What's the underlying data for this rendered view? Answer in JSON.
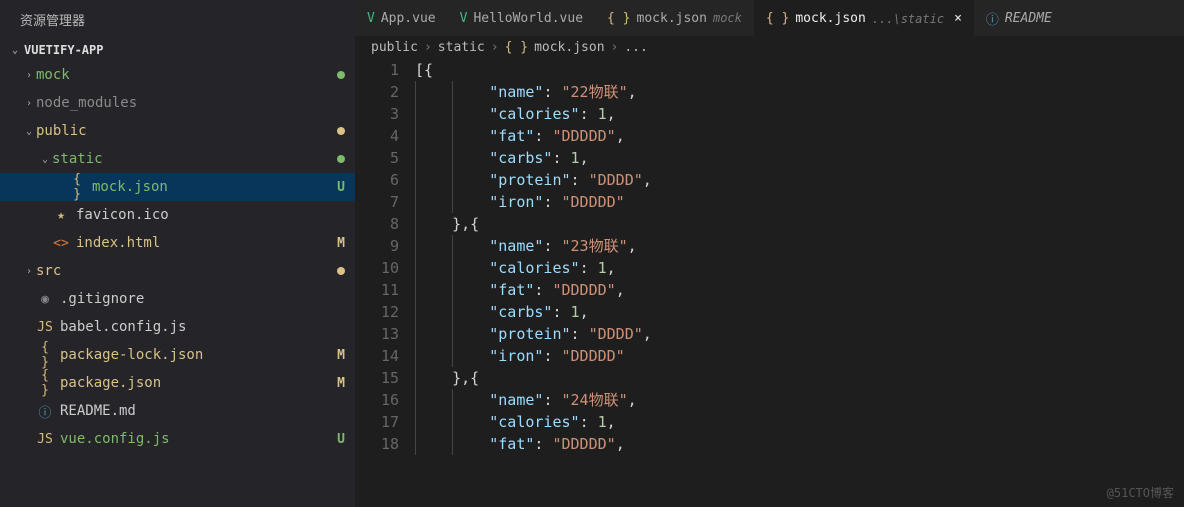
{
  "sidebar": {
    "title": "资源管理器",
    "project": "VUETIFY-APP",
    "tree": [
      {
        "indent": 1,
        "chev": "›",
        "icon": "",
        "iconColor": "",
        "label": "mock",
        "labelColor": "#7fba6a",
        "badge": "",
        "badgeColor": "",
        "dot": "#7fba6a"
      },
      {
        "indent": 1,
        "chev": "›",
        "icon": "",
        "iconColor": "",
        "label": "node_modules",
        "labelColor": "#8a8a8a",
        "badge": "",
        "badgeColor": "",
        "dot": ""
      },
      {
        "indent": 1,
        "chev": "⌄",
        "icon": "",
        "iconColor": "",
        "label": "public",
        "labelColor": "#d8c286",
        "badge": "",
        "badgeColor": "",
        "dot": "#d8c286"
      },
      {
        "indent": 2,
        "chev": "⌄",
        "icon": "",
        "iconColor": "",
        "label": "static",
        "labelColor": "#7fba6a",
        "badge": "",
        "badgeColor": "",
        "dot": "#7fba6a"
      },
      {
        "indent": 3,
        "chev": "",
        "icon": "{ }",
        "iconColor": "#d7ba7d",
        "label": "mock.json",
        "labelColor": "#7fba6a",
        "badge": "U",
        "badgeColor": "#7fba6a",
        "dot": "",
        "active": true
      },
      {
        "indent": 2,
        "chev": "",
        "icon": "★",
        "iconColor": "#d7ba7d",
        "label": "favicon.ico",
        "labelColor": "#ccc",
        "badge": "",
        "badgeColor": "",
        "dot": ""
      },
      {
        "indent": 2,
        "chev": "",
        "icon": "<>",
        "iconColor": "#e37933",
        "label": "index.html",
        "labelColor": "#d8c286",
        "badge": "M",
        "badgeColor": "#d8c286",
        "dot": ""
      },
      {
        "indent": 1,
        "chev": "›",
        "icon": "",
        "iconColor": "",
        "label": "src",
        "labelColor": "#d8c286",
        "badge": "",
        "badgeColor": "",
        "dot": "#d8c286"
      },
      {
        "indent": 1,
        "chev": "",
        "icon": "◉",
        "iconColor": "#888",
        "label": ".gitignore",
        "labelColor": "#ccc",
        "badge": "",
        "badgeColor": "",
        "dot": ""
      },
      {
        "indent": 1,
        "chev": "",
        "icon": "JS",
        "iconColor": "#d7ba7d",
        "label": "babel.config.js",
        "labelColor": "#ccc",
        "badge": "",
        "badgeColor": "",
        "dot": ""
      },
      {
        "indent": 1,
        "chev": "",
        "icon": "{ }",
        "iconColor": "#d7ba7d",
        "label": "package-lock.json",
        "labelColor": "#d8c286",
        "badge": "M",
        "badgeColor": "#d8c286",
        "dot": ""
      },
      {
        "indent": 1,
        "chev": "",
        "icon": "{ }",
        "iconColor": "#d7ba7d",
        "label": "package.json",
        "labelColor": "#d8c286",
        "badge": "M",
        "badgeColor": "#d8c286",
        "dot": ""
      },
      {
        "indent": 1,
        "chev": "",
        "icon": "ⓘ",
        "iconColor": "#519aba",
        "label": "README.md",
        "labelColor": "#ccc",
        "badge": "",
        "badgeColor": "",
        "dot": ""
      },
      {
        "indent": 1,
        "chev": "",
        "icon": "JS",
        "iconColor": "#d7ba7d",
        "label": "vue.config.js",
        "labelColor": "#7fba6a",
        "badge": "U",
        "badgeColor": "#7fba6a",
        "dot": ""
      }
    ]
  },
  "tabs": [
    {
      "icon": "V",
      "iconColor": "#42b883",
      "label": "App.vue",
      "desc": "",
      "close": false,
      "active": false
    },
    {
      "icon": "V",
      "iconColor": "#42b883",
      "label": "HelloWorld.vue",
      "desc": "",
      "close": false,
      "active": false
    },
    {
      "icon": "{ }",
      "iconColor": "#d7ba7d",
      "label": "mock.json",
      "desc": "mock",
      "close": false,
      "active": false
    },
    {
      "icon": "{ }",
      "iconColor": "#d7ba7d",
      "label": "mock.json",
      "desc": "...\\static",
      "close": true,
      "active": true
    },
    {
      "icon": "ⓘ",
      "iconColor": "#519aba",
      "label": "README",
      "desc": "",
      "close": false,
      "active": false,
      "italic": true
    }
  ],
  "breadcrumbs": {
    "parts": [
      "public",
      "static"
    ],
    "fileIcon": "{ }",
    "fileName": "mock.json",
    "tail": "..."
  },
  "code": [
    [
      {
        "t": "[{",
        "c": "p",
        "i": 0
      }
    ],
    [
      {
        "t": "\"name\"",
        "c": "k",
        "i": 2
      },
      {
        "t": ": ",
        "c": "p"
      },
      {
        "t": "\"22物联\"",
        "c": "s"
      },
      {
        "t": ",",
        "c": "p"
      }
    ],
    [
      {
        "t": "\"calories\"",
        "c": "k",
        "i": 2
      },
      {
        "t": ": ",
        "c": "p"
      },
      {
        "t": "1",
        "c": "n"
      },
      {
        "t": ",",
        "c": "p"
      }
    ],
    [
      {
        "t": "\"fat\"",
        "c": "k",
        "i": 2
      },
      {
        "t": ": ",
        "c": "p"
      },
      {
        "t": "\"DDDDD\"",
        "c": "s"
      },
      {
        "t": ",",
        "c": "p"
      }
    ],
    [
      {
        "t": "\"carbs\"",
        "c": "k",
        "i": 2
      },
      {
        "t": ": ",
        "c": "p"
      },
      {
        "t": "1",
        "c": "n"
      },
      {
        "t": ",",
        "c": "p"
      }
    ],
    [
      {
        "t": "\"protein\"",
        "c": "k",
        "i": 2
      },
      {
        "t": ": ",
        "c": "p"
      },
      {
        "t": "\"DDDD\"",
        "c": "s"
      },
      {
        "t": ",",
        "c": "p"
      }
    ],
    [
      {
        "t": "\"iron\"",
        "c": "k",
        "i": 2
      },
      {
        "t": ": ",
        "c": "p"
      },
      {
        "t": "\"DDDDD\"",
        "c": "s"
      }
    ],
    [
      {
        "t": "},{",
        "c": "p",
        "i": 1
      }
    ],
    [
      {
        "t": "\"name\"",
        "c": "k",
        "i": 2
      },
      {
        "t": ": ",
        "c": "p"
      },
      {
        "t": "\"23物联\"",
        "c": "s"
      },
      {
        "t": ",",
        "c": "p"
      }
    ],
    [
      {
        "t": "\"calories\"",
        "c": "k",
        "i": 2
      },
      {
        "t": ": ",
        "c": "p"
      },
      {
        "t": "1",
        "c": "n"
      },
      {
        "t": ",",
        "c": "p"
      }
    ],
    [
      {
        "t": "\"fat\"",
        "c": "k",
        "i": 2
      },
      {
        "t": ": ",
        "c": "p"
      },
      {
        "t": "\"DDDDD\"",
        "c": "s"
      },
      {
        "t": ",",
        "c": "p"
      }
    ],
    [
      {
        "t": "\"carbs\"",
        "c": "k",
        "i": 2
      },
      {
        "t": ": ",
        "c": "p"
      },
      {
        "t": "1",
        "c": "n"
      },
      {
        "t": ",",
        "c": "p"
      }
    ],
    [
      {
        "t": "\"protein\"",
        "c": "k",
        "i": 2
      },
      {
        "t": ": ",
        "c": "p"
      },
      {
        "t": "\"DDDD\"",
        "c": "s"
      },
      {
        "t": ",",
        "c": "p"
      }
    ],
    [
      {
        "t": "\"iron\"",
        "c": "k",
        "i": 2
      },
      {
        "t": ": ",
        "c": "p"
      },
      {
        "t": "\"DDDDD\"",
        "c": "s"
      }
    ],
    [
      {
        "t": "},{",
        "c": "p",
        "i": 1
      }
    ],
    [
      {
        "t": "\"name\"",
        "c": "k",
        "i": 2
      },
      {
        "t": ": ",
        "c": "p"
      },
      {
        "t": "\"24物联\"",
        "c": "s"
      },
      {
        "t": ",",
        "c": "p"
      }
    ],
    [
      {
        "t": "\"calories\"",
        "c": "k",
        "i": 2
      },
      {
        "t": ": ",
        "c": "p"
      },
      {
        "t": "1",
        "c": "n"
      },
      {
        "t": ",",
        "c": "p"
      }
    ],
    [
      {
        "t": "\"fat\"",
        "c": "k",
        "i": 2
      },
      {
        "t": ": ",
        "c": "p"
      },
      {
        "t": "\"DDDDD\"",
        "c": "s"
      },
      {
        "t": ",",
        "c": "p"
      }
    ]
  ],
  "watermark": "@51CTO博客"
}
